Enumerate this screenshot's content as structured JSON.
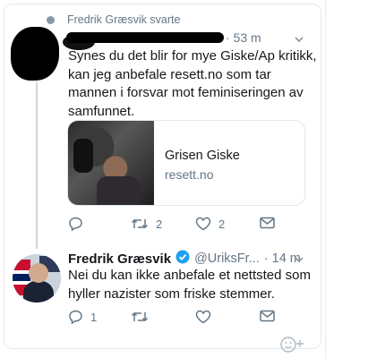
{
  "context": {
    "label": "Fredrik Græsvik svarte"
  },
  "tweet1": {
    "time": "· 53 m",
    "text": "Synes du det blir for mye Giske/Ap kritikk, kan jeg anbefale resett.no som tar mannen i forsvar mot feminiseringen av samfunnet.",
    "link_card": {
      "title": "Grisen Giske",
      "domain": "resett.no"
    },
    "actions": {
      "reply": "",
      "retweet": "2",
      "like": "2"
    }
  },
  "tweet2": {
    "name": "Fredrik Græsvik",
    "handle": "@UriksFr...",
    "time": "· 14 m",
    "text": "Nei du kan ikke anbefale et nettsted som hyller nazister som friske stemmer.",
    "actions": {
      "reply": "1",
      "retweet": "",
      "like": ""
    }
  },
  "icons": {
    "context": "reply-context-icon",
    "chevron": "chevron-down-icon",
    "reply": "reply-icon",
    "retweet": "retweet-icon",
    "like": "heart-icon",
    "dm": "envelope-icon",
    "verified": "verified-badge-icon",
    "compose": "emoji-add-icon"
  },
  "colors": {
    "text": "#14171a",
    "muted": "#657786",
    "border": "#e1e8ed",
    "verified": "#1da1f2"
  }
}
